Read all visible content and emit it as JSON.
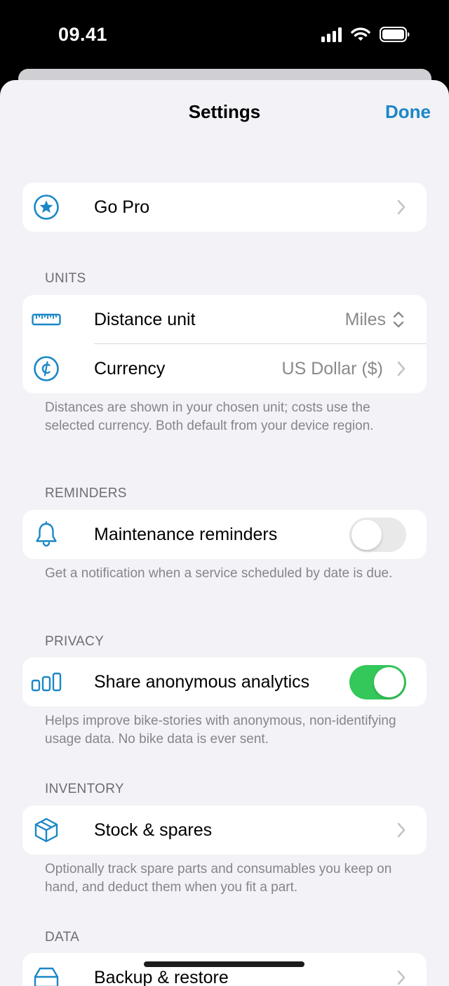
{
  "status_bar": {
    "time": "09.41"
  },
  "navigation": {
    "title": "Settings",
    "done_label": "Done"
  },
  "go_pro": {
    "label": "Go Pro",
    "icon": "star-circle-icon"
  },
  "units": {
    "header": "UNITS",
    "distance": {
      "label": "Distance unit",
      "value": "Miles",
      "icon": "ruler-icon"
    },
    "currency": {
      "label": "Currency",
      "value": "US Dollar ($)",
      "icon": "cent-circle-icon"
    },
    "footer": "Distances are shown in your chosen unit; costs use the selected currency. Both default from your device region."
  },
  "reminders": {
    "header": "REMINDERS",
    "maintenance": {
      "label": "Maintenance reminders",
      "enabled": false,
      "icon": "bell-icon"
    },
    "footer": "Get a notification when a service scheduled by date is due."
  },
  "privacy": {
    "header": "PRIVACY",
    "analytics": {
      "label": "Share anonymous analytics",
      "enabled": true,
      "icon": "chart-bars-icon"
    },
    "footer": "Helps improve bike-stories with anonymous, non-identifying usage data. No bike data is ever sent."
  },
  "inventory": {
    "header": "INVENTORY",
    "stock": {
      "label": "Stock & spares",
      "icon": "box-icon"
    },
    "footer": "Optionally track spare parts and consumables you keep on hand, and deduct them when you fit a part."
  },
  "data_section": {
    "header": "DATA",
    "backup": {
      "label": "Backup & restore",
      "icon": "backup-icon"
    }
  },
  "colors": {
    "accent": "#1a87c7",
    "toggle_on": "#34c759",
    "toggle_off": "#e9e9ea",
    "background": "#f2f2f7"
  }
}
